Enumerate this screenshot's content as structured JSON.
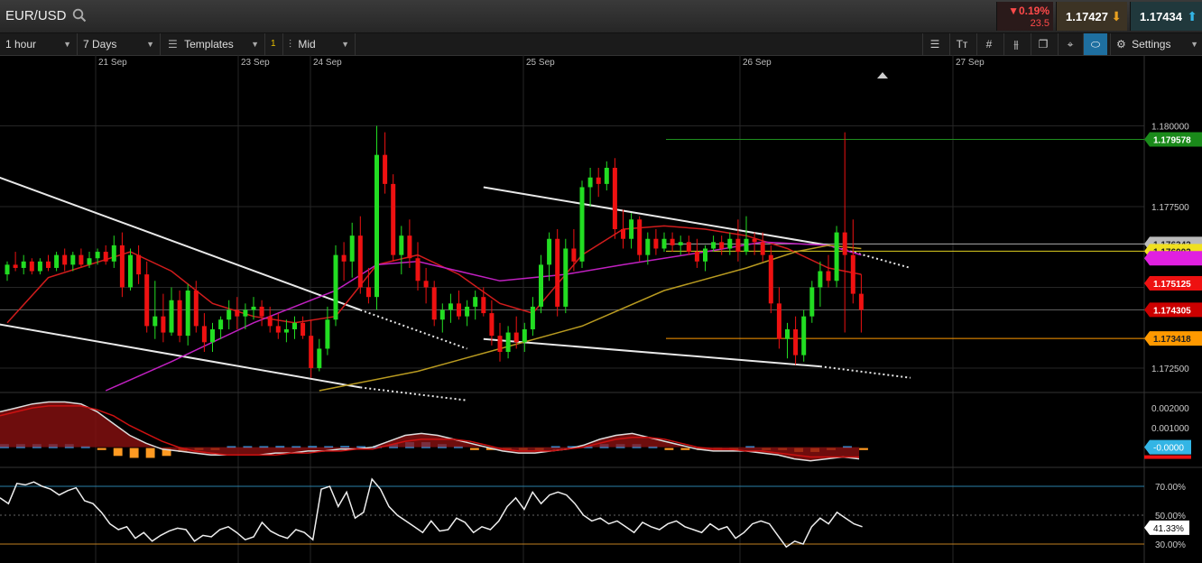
{
  "header": {
    "symbol": "EUR/USD",
    "change_pct": "0.19%",
    "change_points": "23.5",
    "bid": "1.17427",
    "ask": "1.17434",
    "down_color": "#ff4a4a",
    "bid_arrow_color": "#e8a020",
    "ask_arrow_color": "#33b5e5"
  },
  "toolbar": {
    "interval": "1 hour",
    "range": "7 Days",
    "templates_label": "Templates",
    "badge": "1",
    "price_mode": "Mid",
    "settings_label": "Settings"
  },
  "icons": {
    "search": "search-icon",
    "down_arrow": "down-triangle-icon",
    "bid_arrow": "arrow-down-icon",
    "ask_arrow": "arrow-up-icon",
    "templates": "templates-icon",
    "price": "price-icon",
    "text": "text-icon",
    "grid": "grid-icon",
    "candles": "candles-icon",
    "windows": "windows-icon",
    "crosshair": "crosshair-icon",
    "tag": "tag-icon",
    "gear": "gear-icon",
    "chevron": "chevron-down-icon"
  },
  "chart_data": {
    "type": "candlestick",
    "x_ticks": [
      "21 Sep",
      "23 Sep",
      "24 Sep",
      "25 Sep",
      "26 Sep",
      "27 Sep"
    ],
    "ylim": [
      1.1718,
      1.1818
    ],
    "y_ticks": [
      "1.180000",
      "1.177500",
      "1.172500"
    ],
    "candles": [
      [
        1.1754,
        1.1758,
        1.1752,
        1.1757
      ],
      [
        1.1757,
        1.1761,
        1.1755,
        1.1756
      ],
      [
        1.1756,
        1.176,
        1.1754,
        1.1758
      ],
      [
        1.1758,
        1.1759,
        1.1754,
        1.1755
      ],
      [
        1.1755,
        1.1759,
        1.1754,
        1.1758
      ],
      [
        1.1758,
        1.176,
        1.1755,
        1.1756
      ],
      [
        1.1756,
        1.1761,
        1.1755,
        1.176
      ],
      [
        1.176,
        1.1762,
        1.1755,
        1.1757
      ],
      [
        1.1757,
        1.1761,
        1.1755,
        1.176
      ],
      [
        1.176,
        1.1762,
        1.1756,
        1.1757
      ],
      [
        1.1757,
        1.1761,
        1.1756,
        1.1759
      ],
      [
        1.1759,
        1.1762,
        1.1757,
        1.1761
      ],
      [
        1.1761,
        1.1763,
        1.1757,
        1.1758
      ],
      [
        1.1758,
        1.1766,
        1.1756,
        1.1763
      ],
      [
        1.1763,
        1.1767,
        1.1747,
        1.175
      ],
      [
        1.175,
        1.1762,
        1.1749,
        1.176
      ],
      [
        1.176,
        1.1763,
        1.1751,
        1.1754
      ],
      [
        1.1754,
        1.1758,
        1.1736,
        1.1738
      ],
      [
        1.1738,
        1.1752,
        1.1734,
        1.1741
      ],
      [
        1.1741,
        1.1748,
        1.1733,
        1.1736
      ],
      [
        1.1736,
        1.175,
        1.1735,
        1.1746
      ],
      [
        1.1746,
        1.1749,
        1.1733,
        1.1735
      ],
      [
        1.1735,
        1.1751,
        1.1732,
        1.1749
      ],
      [
        1.1749,
        1.1752,
        1.1736,
        1.1738
      ],
      [
        1.1738,
        1.1742,
        1.173,
        1.1733
      ],
      [
        1.1733,
        1.1739,
        1.173,
        1.1737
      ],
      [
        1.1737,
        1.1741,
        1.1734,
        1.174
      ],
      [
        1.174,
        1.1746,
        1.1737,
        1.1743
      ],
      [
        1.1743,
        1.1747,
        1.1737,
        1.1741
      ],
      [
        1.1741,
        1.1745,
        1.1737,
        1.1743
      ],
      [
        1.1743,
        1.1747,
        1.174,
        1.1744
      ],
      [
        1.1744,
        1.1746,
        1.1738,
        1.1741
      ],
      [
        1.1741,
        1.1744,
        1.1736,
        1.1738
      ],
      [
        1.1738,
        1.1742,
        1.1734,
        1.1736
      ],
      [
        1.1736,
        1.174,
        1.1733,
        1.1737
      ],
      [
        1.1737,
        1.1741,
        1.1734,
        1.1739
      ],
      [
        1.1739,
        1.1741,
        1.1734,
        1.1735
      ],
      [
        1.1735,
        1.174,
        1.1722,
        1.1725
      ],
      [
        1.1725,
        1.1734,
        1.1724,
        1.1731
      ],
      [
        1.1731,
        1.1744,
        1.1729,
        1.174
      ],
      [
        1.174,
        1.1763,
        1.1738,
        1.176
      ],
      [
        1.176,
        1.1764,
        1.1752,
        1.1758
      ],
      [
        1.1758,
        1.177,
        1.1753,
        1.1766
      ],
      [
        1.1766,
        1.1772,
        1.1748,
        1.175
      ],
      [
        1.175,
        1.1756,
        1.1745,
        1.1747
      ],
      [
        1.1747,
        1.18,
        1.1743,
        1.1791
      ],
      [
        1.1791,
        1.1798,
        1.1779,
        1.1782
      ],
      [
        1.1782,
        1.1785,
        1.1758,
        1.176
      ],
      [
        1.176,
        1.1769,
        1.1754,
        1.1766
      ],
      [
        1.1766,
        1.1771,
        1.1756,
        1.1759
      ],
      [
        1.1759,
        1.1764,
        1.1749,
        1.1752
      ],
      [
        1.1752,
        1.1756,
        1.1745,
        1.175
      ],
      [
        1.175,
        1.1752,
        1.1738,
        1.174
      ],
      [
        1.174,
        1.1745,
        1.1736,
        1.1743
      ],
      [
        1.1743,
        1.1748,
        1.1739,
        1.1745
      ],
      [
        1.1745,
        1.1749,
        1.174,
        1.1741
      ],
      [
        1.1741,
        1.1746,
        1.1738,
        1.1744
      ],
      [
        1.1744,
        1.1749,
        1.174,
        1.1747
      ],
      [
        1.1747,
        1.175,
        1.1741,
        1.1742
      ],
      [
        1.1742,
        1.1746,
        1.1732,
        1.1735
      ],
      [
        1.1735,
        1.1739,
        1.1727,
        1.173
      ],
      [
        1.173,
        1.1738,
        1.1728,
        1.1736
      ],
      [
        1.1736,
        1.1741,
        1.1731,
        1.1733
      ],
      [
        1.1733,
        1.1739,
        1.173,
        1.1737
      ],
      [
        1.1737,
        1.1747,
        1.1735,
        1.1744
      ],
      [
        1.1744,
        1.176,
        1.1742,
        1.1757
      ],
      [
        1.1757,
        1.1767,
        1.1752,
        1.1765
      ],
      [
        1.1765,
        1.1768,
        1.1741,
        1.1744
      ],
      [
        1.1744,
        1.1765,
        1.1742,
        1.1762
      ],
      [
        1.1762,
        1.1768,
        1.1755,
        1.1758
      ],
      [
        1.1758,
        1.1783,
        1.1756,
        1.1781
      ],
      [
        1.1781,
        1.1787,
        1.1775,
        1.1784
      ],
      [
        1.1784,
        1.1787,
        1.1778,
        1.1782
      ],
      [
        1.1782,
        1.1789,
        1.178,
        1.1787
      ],
      [
        1.1787,
        1.179,
        1.1765,
        1.1768
      ],
      [
        1.1768,
        1.1774,
        1.1762,
        1.1765
      ],
      [
        1.1765,
        1.1773,
        1.1762,
        1.1771
      ],
      [
        1.1771,
        1.1772,
        1.1758,
        1.176
      ],
      [
        1.176,
        1.1767,
        1.1757,
        1.1765
      ],
      [
        1.1765,
        1.1768,
        1.176,
        1.1762
      ],
      [
        1.1762,
        1.1767,
        1.1761,
        1.1765
      ],
      [
        1.1765,
        1.1767,
        1.1761,
        1.1763
      ],
      [
        1.1763,
        1.1766,
        1.176,
        1.1764
      ],
      [
        1.1764,
        1.1766,
        1.176,
        1.1761
      ],
      [
        1.1761,
        1.1765,
        1.1756,
        1.1758
      ],
      [
        1.1758,
        1.1763,
        1.1755,
        1.1762
      ],
      [
        1.1762,
        1.1766,
        1.1761,
        1.1764
      ],
      [
        1.1764,
        1.1766,
        1.176,
        1.1762
      ],
      [
        1.1762,
        1.1767,
        1.176,
        1.1765
      ],
      [
        1.1765,
        1.1771,
        1.1758,
        1.1761
      ],
      [
        1.1761,
        1.1772,
        1.176,
        1.1765
      ],
      [
        1.1765,
        1.1767,
        1.176,
        1.1764
      ],
      [
        1.1764,
        1.1767,
        1.1758,
        1.176
      ],
      [
        1.176,
        1.1763,
        1.1742,
        1.1745
      ],
      [
        1.1745,
        1.175,
        1.1731,
        1.1734
      ],
      [
        1.1734,
        1.1739,
        1.1728,
        1.1737
      ],
      [
        1.1737,
        1.1741,
        1.1726,
        1.1729
      ],
      [
        1.1729,
        1.1743,
        1.1727,
        1.1741
      ],
      [
        1.1741,
        1.1752,
        1.1739,
        1.175
      ],
      [
        1.175,
        1.1758,
        1.1744,
        1.1755
      ],
      [
        1.1755,
        1.176,
        1.175,
        1.1752
      ],
      [
        1.1752,
        1.1769,
        1.175,
        1.1767
      ],
      [
        1.1767,
        1.1798,
        1.1736,
        1.176
      ],
      [
        1.176,
        1.1771,
        1.1745,
        1.1748
      ],
      [
        1.1748,
        1.1754,
        1.1736,
        1.1743
      ]
    ],
    "overlays": [
      {
        "name": "red-ma",
        "color": "#d01c1c",
        "values": [
          [
            0,
            1.1739
          ],
          [
            5,
            1.1753
          ],
          [
            10,
            1.1757
          ],
          [
            15,
            1.1761
          ],
          [
            20,
            1.1755
          ],
          [
            25,
            1.1745
          ],
          [
            30,
            1.1741
          ],
          [
            35,
            1.1739
          ],
          [
            40,
            1.1741
          ],
          [
            45,
            1.1757
          ],
          [
            50,
            1.176
          ],
          [
            55,
            1.1754
          ],
          [
            60,
            1.1745
          ],
          [
            64,
            1.1742
          ],
          [
            70,
            1.176
          ],
          [
            75,
            1.1768
          ],
          [
            80,
            1.1769
          ],
          [
            85,
            1.1768
          ],
          [
            90,
            1.1766
          ],
          [
            95,
            1.1762
          ],
          [
            100,
            1.1756
          ],
          [
            104,
            1.1754
          ]
        ]
      },
      {
        "name": "purple-ma",
        "color": "#c020c0",
        "values": [
          [
            12,
            1.1718
          ],
          [
            20,
            1.1727
          ],
          [
            30,
            1.1739
          ],
          [
            40,
            1.1749
          ],
          [
            45,
            1.1757
          ],
          [
            50,
            1.1758
          ],
          [
            60,
            1.1752
          ],
          [
            68,
            1.1754
          ],
          [
            75,
            1.1757
          ],
          [
            85,
            1.1761
          ],
          [
            92,
            1.1764
          ],
          [
            100,
            1.1763
          ],
          [
            104,
            1.176
          ]
        ]
      },
      {
        "name": "olive-ma",
        "color": "#b89a20",
        "values": [
          [
            38,
            1.1718
          ],
          [
            50,
            1.1724
          ],
          [
            60,
            1.1731
          ],
          [
            70,
            1.1738
          ],
          [
            80,
            1.1749
          ],
          [
            90,
            1.1756
          ],
          [
            96,
            1.1761
          ],
          [
            100,
            1.1763
          ],
          [
            104,
            1.1762
          ]
        ]
      }
    ],
    "price_levels": [
      {
        "label": "1.179578",
        "value": 1.179578,
        "color": "#1a8a1a",
        "line": "#1f8f1f"
      },
      {
        "label": "1.176342",
        "value": 1.176342,
        "color": "#bbbbbb",
        "line": "#aaaaaa"
      },
      {
        "label": "1.176002",
        "value": 1.17612,
        "color": "#f0e020",
        "line": "#e0d020"
      },
      {
        "label": "",
        "value": 1.1759,
        "color": "#e020e0",
        "line": "none"
      },
      {
        "label": "1.175125",
        "value": 1.175125,
        "color": "#ee1111",
        "line": "none"
      },
      {
        "label": "1.174305",
        "value": 1.174305,
        "color": "#cc0000",
        "line": "#666666"
      },
      {
        "label": "1.173418",
        "value": 1.173418,
        "color": "#ff9900",
        "line": "#ff9900"
      }
    ],
    "trendlines": [
      {
        "p1": [
          -2,
          1.1785
        ],
        "p2": [
          43,
          1.1743
        ],
        "dotted_to": [
          56,
          1.1731
        ]
      },
      {
        "p1": [
          -2,
          1.1739
        ],
        "p2": [
          43,
          1.1719
        ],
        "dotted_to": [
          56,
          1.1715
        ]
      },
      {
        "p1": [
          58,
          1.1781
        ],
        "p2": [
          100,
          1.1763
        ],
        "dotted_to": [
          110,
          1.1756
        ]
      },
      {
        "p1": [
          58,
          1.1734
        ],
        "p2": [
          99,
          1.17255
        ],
        "dotted_to": [
          110,
          1.1722
        ]
      }
    ],
    "macd": {
      "y_ticks": [
        "0.002000",
        "0.001000"
      ],
      "value": "-0.0000",
      "value_color": "#33b5e5",
      "line1": [
        0.0018,
        0.002,
        0.0022,
        0.0023,
        0.0023,
        0.0022,
        0.0018,
        0.0012,
        0.0006,
        0.0002,
        -0.0001,
        -0.0002,
        -0.0003,
        -0.0004,
        -0.0004,
        -0.0004,
        -0.0004,
        -0.0003,
        -0.0003,
        -0.0002,
        -0.0002,
        -0.0001,
        -0.0001,
        0.0,
        0.0003,
        0.0006,
        0.0007,
        0.0006,
        0.0004,
        0.0002,
        0.0,
        -0.0002,
        -0.0003,
        -0.0003,
        -0.0002,
        -0.0001,
        0.0001,
        0.0004,
        0.0006,
        0.0007,
        0.0005,
        0.0003,
        0.0001,
        -0.0001,
        -0.0002,
        -0.0002,
        -0.0002,
        -0.0003,
        -0.0004,
        -0.0006,
        -0.0007,
        -0.0006,
        -0.0005,
        -0.0006
      ],
      "line2": [
        0.0016,
        0.0018,
        0.002,
        0.0021,
        0.0021,
        0.0021,
        0.0019,
        0.0016,
        0.0011,
        0.0007,
        0.0003,
        0.0,
        -0.0002,
        -0.0003,
        -0.0004,
        -0.0004,
        -0.0004,
        -0.0004,
        -0.0003,
        -0.0003,
        -0.0002,
        -0.0002,
        -0.0001,
        -0.0001,
        0.0001,
        0.0003,
        0.0004,
        0.0004,
        0.0004,
        0.0003,
        0.0001,
        -0.0001,
        -0.0002,
        -0.0002,
        -0.0002,
        -0.0001,
        0.0,
        0.0002,
        0.0004,
        0.0005,
        0.0005,
        0.0004,
        0.0002,
        0.0,
        -0.0001,
        -0.0001,
        -0.0002,
        -0.0002,
        -0.0003,
        -0.0004,
        -0.0005,
        -0.0005,
        -0.0005,
        -0.0005
      ],
      "hist": [
        0.0002,
        0.0002,
        0.0002,
        0.0002,
        0.0002,
        0.0001,
        -0.0001,
        -0.0004,
        -0.0005,
        -0.0005,
        -0.0004,
        -0.0002,
        -0.0001,
        -0.0001,
        0.0,
        0.0,
        0.0,
        0.0001,
        0.0,
        0.0001,
        0.0,
        0.0001,
        0.0,
        0.0001,
        0.0002,
        0.0003,
        0.0003,
        0.0002,
        0.0,
        -0.0001,
        -0.0001,
        -0.0001,
        -0.0001,
        -0.0001,
        0.0,
        0.0,
        0.0001,
        0.0002,
        0.0002,
        0.0002,
        0.0,
        -0.0001,
        -0.0001,
        -0.0001,
        -0.0001,
        -0.0001,
        0.0,
        -0.0001,
        -0.0001,
        -0.0002,
        -0.0002,
        -0.0001,
        0.0,
        -0.0001
      ]
    },
    "rsi": {
      "levels": [
        "70.00%",
        "50.00%",
        "30.00%"
      ],
      "value": "41.33%",
      "values": [
        62,
        58,
        72,
        71,
        73,
        70,
        68,
        64,
        67,
        69,
        60,
        58,
        52,
        44,
        40,
        42,
        34,
        38,
        32,
        36,
        39,
        41,
        40,
        32,
        36,
        35,
        40,
        42,
        38,
        33,
        35,
        45,
        39,
        36,
        34,
        40,
        38,
        33,
        68,
        70,
        56,
        66,
        48,
        52,
        75,
        68,
        56,
        50,
        46,
        42,
        38,
        46,
        39,
        40,
        48,
        45,
        38,
        42,
        40,
        46,
        56,
        62,
        54,
        66,
        58,
        64,
        66,
        64,
        58,
        50,
        46,
        48,
        44,
        46,
        42,
        38,
        45,
        42,
        40,
        44,
        46,
        42,
        40,
        38,
        44,
        40,
        42,
        34,
        38,
        44,
        46,
        44,
        36,
        28,
        32,
        30,
        42,
        48,
        44,
        52,
        48,
        44,
        42
      ]
    }
  }
}
